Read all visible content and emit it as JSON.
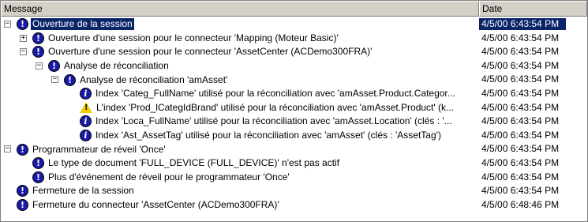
{
  "columns": {
    "message": "Message",
    "date": "Date"
  },
  "rows": [
    {
      "level": 0,
      "expander": "−",
      "icon": "exclamation-icon",
      "text": "Ouverture de la session",
      "date": "4/5/00 6:43:54 PM",
      "selected": true
    },
    {
      "level": 1,
      "expander": "+",
      "icon": "exclamation-icon",
      "text": "Ouverture d'une session pour le connecteur 'Mapping (Moteur Basic)'",
      "date": "4/5/00 6:43:54 PM"
    },
    {
      "level": 1,
      "expander": "−",
      "icon": "exclamation-icon",
      "text": "Ouverture d'une session pour le connecteur 'AssetCenter (ACDemo300FRA)'",
      "date": "4/5/00 6:43:54 PM"
    },
    {
      "level": 2,
      "expander": "−",
      "icon": "exclamation-icon",
      "text": "Analyse de réconciliation",
      "date": "4/5/00 6:43:54 PM"
    },
    {
      "level": 3,
      "expander": "−",
      "icon": "exclamation-icon",
      "text": "Analyse de réconciliation 'amAsset'",
      "date": "4/5/00 6:43:54 PM"
    },
    {
      "level": 4,
      "expander": "",
      "icon": "info-icon",
      "text": "Index 'Categ_FullName' utilisé pour la réconciliation avec 'amAsset.Product.Categor...",
      "date": "4/5/00 6:43:54 PM"
    },
    {
      "level": 4,
      "expander": "",
      "icon": "warning-icon",
      "text": "L'index 'Prod_lCategIdBrand' utilisé pour la réconciliation avec 'amAsset.Product' (k...",
      "date": "4/5/00 6:43:54 PM"
    },
    {
      "level": 4,
      "expander": "",
      "icon": "info-icon",
      "text": "Index 'Loca_FullName' utilisé pour la réconciliation avec 'amAsset.Location' (clés : '...",
      "date": "4/5/00 6:43:54 PM"
    },
    {
      "level": 4,
      "expander": "",
      "icon": "info-icon",
      "text": "Index 'Ast_AssetTag' utilisé pour la réconciliation avec 'amAsset' (clés : 'AssetTag')",
      "date": "4/5/00 6:43:54 PM"
    },
    {
      "level": 0,
      "expander": "−",
      "icon": "exclamation-icon",
      "text": "Programmateur de réveil 'Once'",
      "date": "4/5/00 6:43:54 PM"
    },
    {
      "level": 1,
      "expander": "",
      "icon": "exclamation-icon",
      "text": "Le type de document 'FULL_DEVICE (FULL_DEVICE)' n'est pas actif",
      "date": "4/5/00 6:43:54 PM"
    },
    {
      "level": 1,
      "expander": "",
      "icon": "exclamation-icon",
      "text": "Plus d'événement de réveil pour le programmateur 'Once'",
      "date": "4/5/00 6:43:54 PM"
    },
    {
      "level": 0,
      "expander": "",
      "icon": "exclamation-icon",
      "text": "Fermeture de la session",
      "date": "4/5/00 6:43:54 PM"
    },
    {
      "level": 0,
      "expander": "",
      "icon": "exclamation-icon",
      "text": "Fermeture du connecteur 'AssetCenter (ACDemo300FRA)'",
      "date": "4/5/00 6:48:46 PM"
    }
  ]
}
